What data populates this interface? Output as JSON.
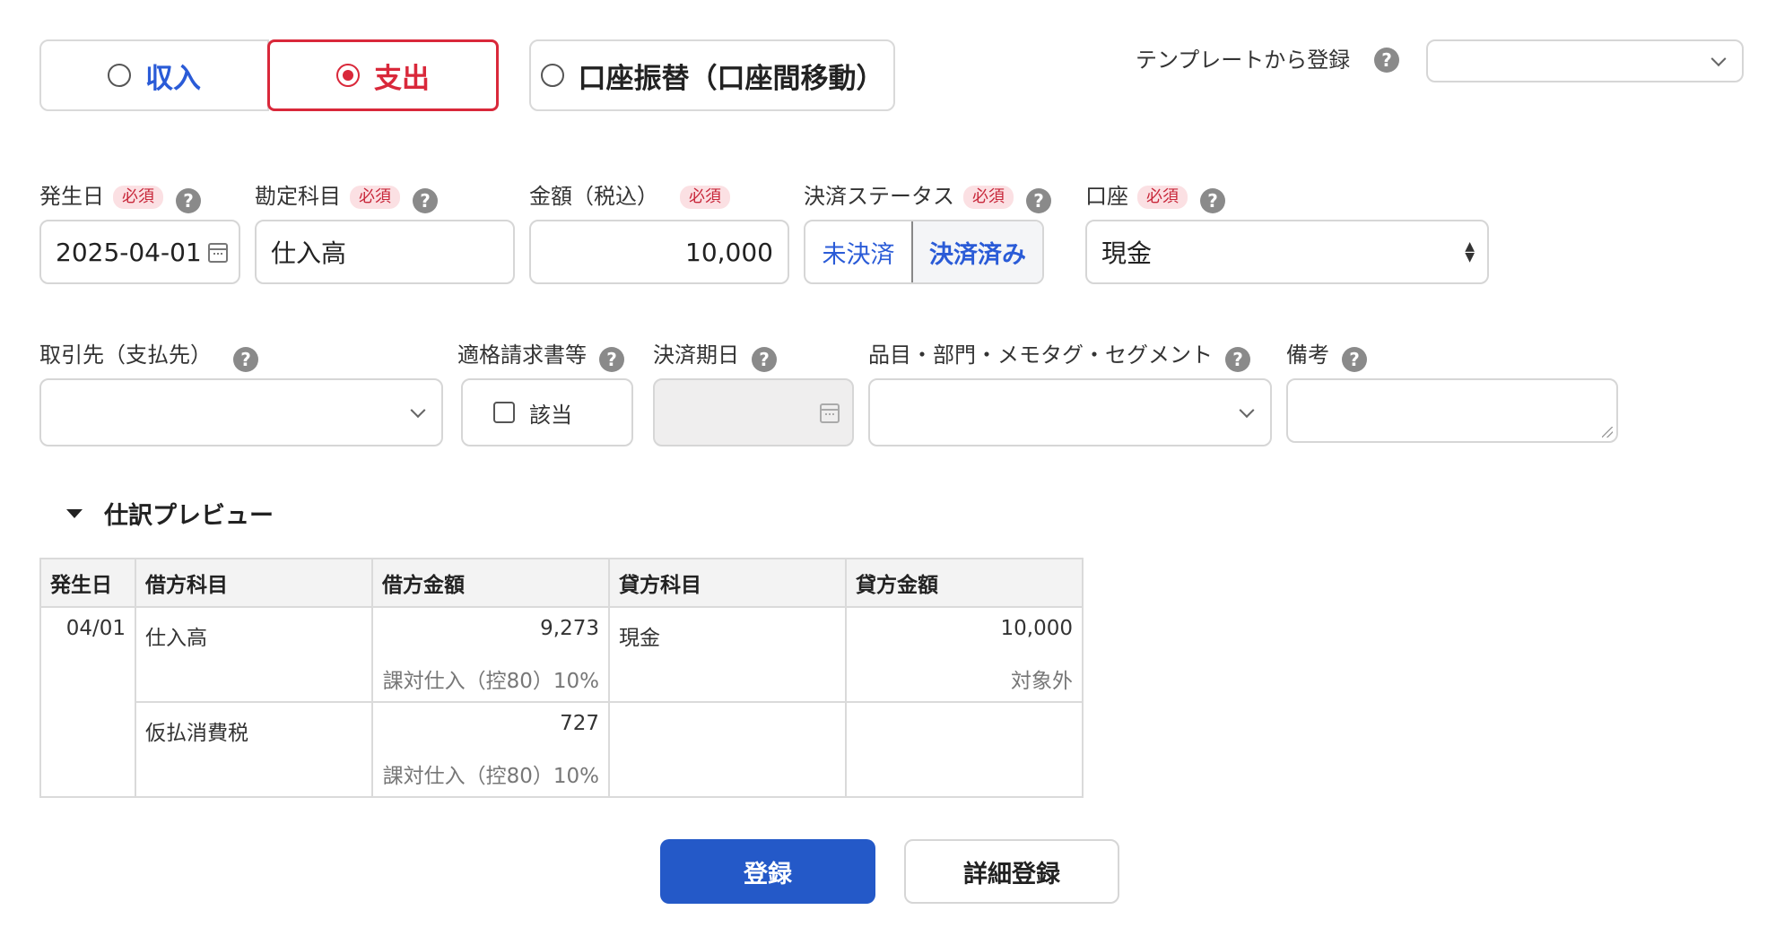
{
  "type_toggle": {
    "income": "収入",
    "expense": "支出",
    "transfer": "口座振替（口座間移動）",
    "selected": "expense"
  },
  "template": {
    "label": "テンプレートから登録",
    "value": ""
  },
  "help_glyph": "?",
  "required_badge": "必須",
  "fields": {
    "date": {
      "label": "発生日",
      "value": "2025-04-01"
    },
    "account": {
      "label": "勘定科目",
      "value": "仕入高"
    },
    "amount": {
      "label": "金額（税込）",
      "value": "10,000"
    },
    "status": {
      "label": "決済ステータス",
      "unpaid": "未決済",
      "paid": "決済済み",
      "selected": "paid"
    },
    "wallet": {
      "label": "口座",
      "value": "現金"
    },
    "partner": {
      "label": "取引先（支払先）",
      "value": ""
    },
    "invoice": {
      "label": "適格請求書等",
      "checkbox_label": "該当",
      "checked": false
    },
    "due_date": {
      "label": "決済期日",
      "value": ""
    },
    "items": {
      "label": "品目・部門・メモタグ・セグメント",
      "value": ""
    },
    "memo": {
      "label": "備考",
      "value": ""
    }
  },
  "preview": {
    "title": "仕訳プレビュー",
    "headers": [
      "発生日",
      "借方科目",
      "借方金額",
      "貸方科目",
      "貸方金額"
    ],
    "date": "04/01",
    "rows": [
      {
        "debit_account": "仕入高",
        "debit_amount": "9,273",
        "debit_tax": "課対仕入（控80）10%",
        "credit_account": "現金",
        "credit_amount": "10,000",
        "credit_tax": "対象外"
      },
      {
        "debit_account": "仮払消費税",
        "debit_amount": "727",
        "debit_tax": "課対仕入（控80）10%",
        "credit_account": "",
        "credit_amount": "",
        "credit_tax": ""
      }
    ]
  },
  "buttons": {
    "register": "登録",
    "detail_register": "詳細登録"
  },
  "colors": {
    "accent_blue": "#2459c8",
    "expense_red": "#d9283a",
    "required_bg": "#fbe0e3"
  }
}
